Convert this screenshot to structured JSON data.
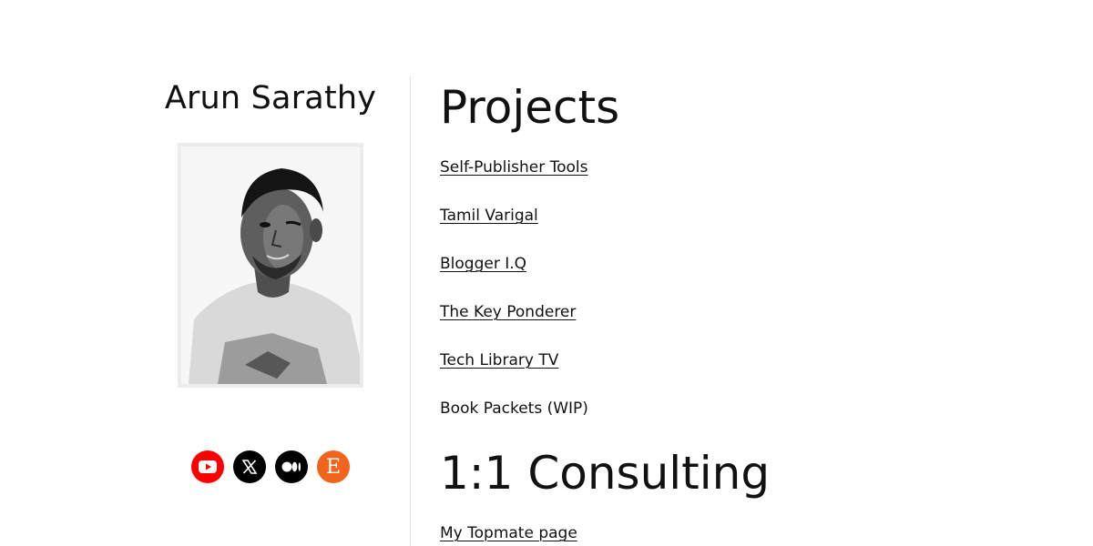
{
  "profile": {
    "name": "Arun Sarathy",
    "portrait_alt": "portrait photo"
  },
  "socials": [
    {
      "name": "youtube",
      "icon": "youtube-icon",
      "color": "#ff0000"
    },
    {
      "name": "x",
      "icon": "x-icon",
      "color": "#000000"
    },
    {
      "name": "medium",
      "icon": "medium-icon",
      "color": "#000000"
    },
    {
      "name": "etsy",
      "icon": "etsy-icon",
      "color": "#f1641e"
    }
  ],
  "projects": {
    "title": "Projects",
    "items": [
      {
        "label": "Self-Publisher Tools",
        "link": true
      },
      {
        "label": "Tamil Varigal",
        "link": true
      },
      {
        "label": "Blogger I.Q",
        "link": true
      },
      {
        "label": "The Key Ponderer",
        "link": true
      },
      {
        "label": "Tech Library TV",
        "link": true
      },
      {
        "label": "Book Packets (WIP)",
        "link": false
      }
    ]
  },
  "consulting": {
    "title": "1:1 Consulting",
    "items": [
      {
        "label": "My Topmate page",
        "link": true
      }
    ]
  }
}
